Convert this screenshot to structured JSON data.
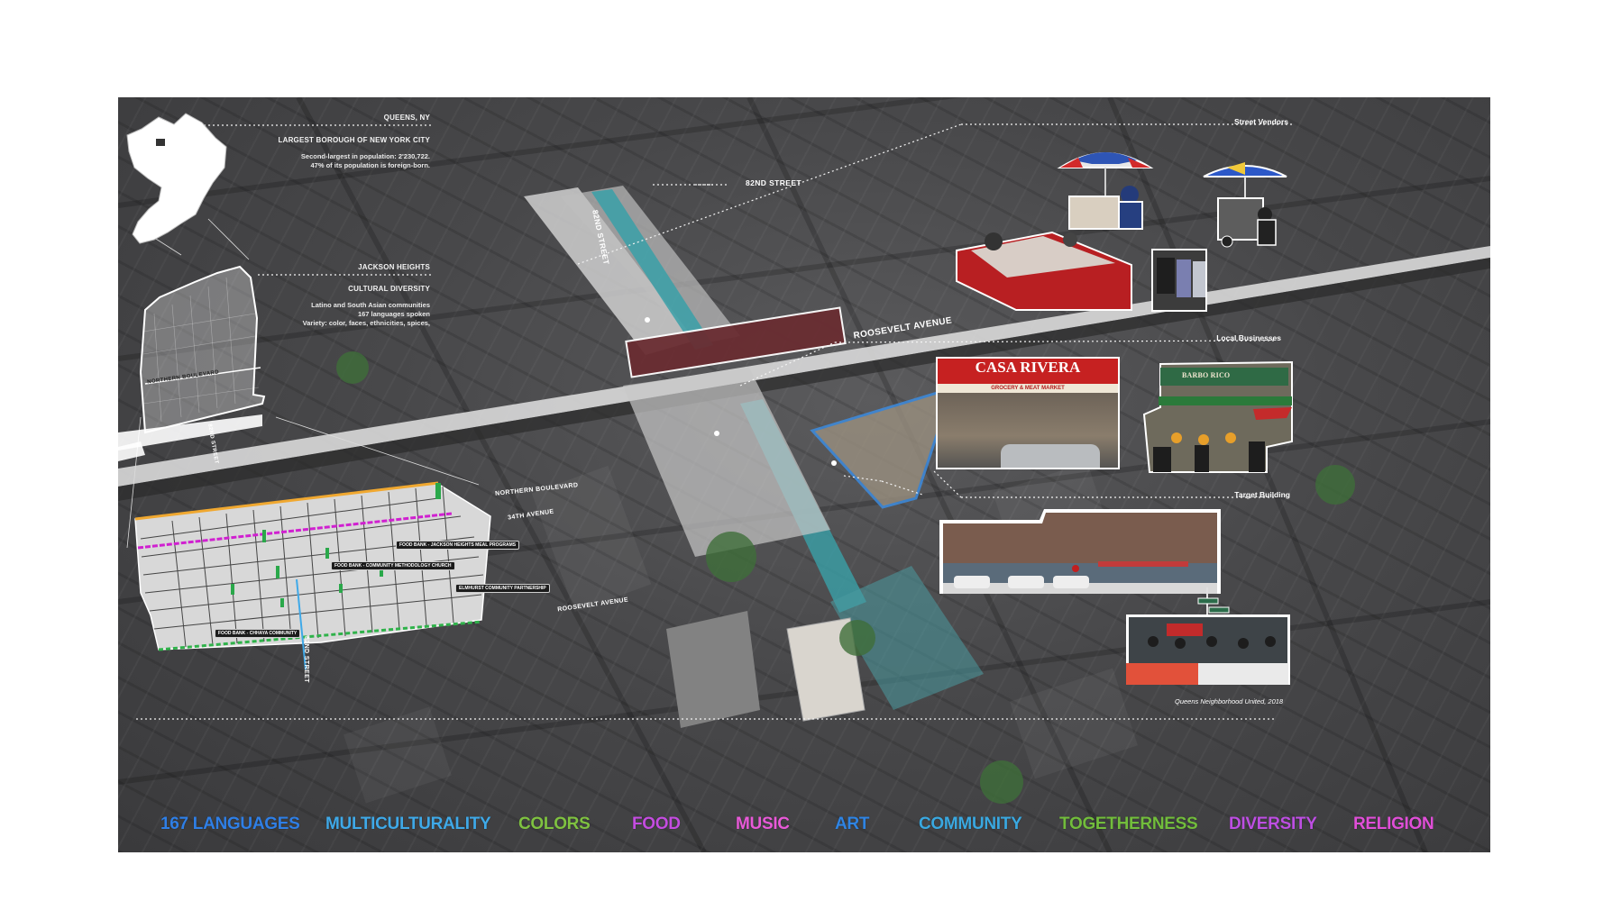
{
  "queens": {
    "title": "QUEENS, NY",
    "subtitle": "LARGEST BOROUGH OF NEW YORK CITY",
    "body_line1": "Second-largest in population: 2'230,722.",
    "body_line2": "47% of its population is foreign-born."
  },
  "jackson": {
    "title": "JACKSON HEIGHTS",
    "subtitle": "CULTURAL DIVERSITY",
    "body_line1": "Latino and South Asian communities",
    "body_line2": "167 languages spoken",
    "body_line3": "Variety: color, faces, ethnicities, spices,"
  },
  "streets": {
    "street_82nd_top": "82ND STREET",
    "street_82nd_vertical": "82ND STREET",
    "roosevelt_main": "ROOSEVELT AVENUE",
    "northern_blvd_small": "NORTHERN BOULEVARD",
    "street_82nd_small": "82ND STREET",
    "northern_blvd_map": "NORTHERN BOULEVARD",
    "avenue_34th": "34TH AVENUE",
    "roosevelt_map": "ROOSEVELT AVENUE",
    "street_82nd_map": "82ND STREET"
  },
  "food_banks": [
    "FOOD BANK - JACKSON HEIGHTS MEAL PROGRAMS",
    "FOOD BANK - COMMUNITY METHODOLOGY CHURCH",
    "ELMHURST COMMUNITY PARTNERSHIP",
    "FOOD BANK - CHHAYA COMMUNITY"
  ],
  "sections": {
    "street_vendors": "Street Vendors",
    "local_businesses": "Local Businesses",
    "target_building": "Target Building"
  },
  "signs": {
    "casa_rivera": "CASA RIVERA",
    "casa_rivera_sub": "GROCERY & MEAT MARKET",
    "barbo": "BARBO RICO"
  },
  "credit": "Queens Neighborhood United, 2018",
  "keywords": [
    {
      "label": "167 LANGUAGES",
      "color": "#2f7fe6"
    },
    {
      "label": "MULTICULTURALITY",
      "color": "#3fa9e8"
    },
    {
      "label": "COLORS",
      "color": "#7fc241"
    },
    {
      "label": "FOOD",
      "color": "#c44de0"
    },
    {
      "label": "MUSIC",
      "color": "#e85ad8"
    },
    {
      "label": "ART",
      "color": "#2f84e3"
    },
    {
      "label": "COMMUNITY",
      "color": "#3aa8e0"
    },
    {
      "label": "TOGETHERNESS",
      "color": "#72bd3c"
    },
    {
      "label": "DIVERSITY",
      "color": "#bd4fe2"
    },
    {
      "label": "RELIGION",
      "color": "#e04fd8"
    }
  ],
  "colors": {
    "northern_blvd": "#f0a830",
    "avenue_34th": "#d020d0",
    "food_bank_marker": "#2aa84a",
    "roosevelt_marker": "#2fb24a",
    "target_outline": "#3b8fe8",
    "street_channel": "#3aa0a8"
  }
}
